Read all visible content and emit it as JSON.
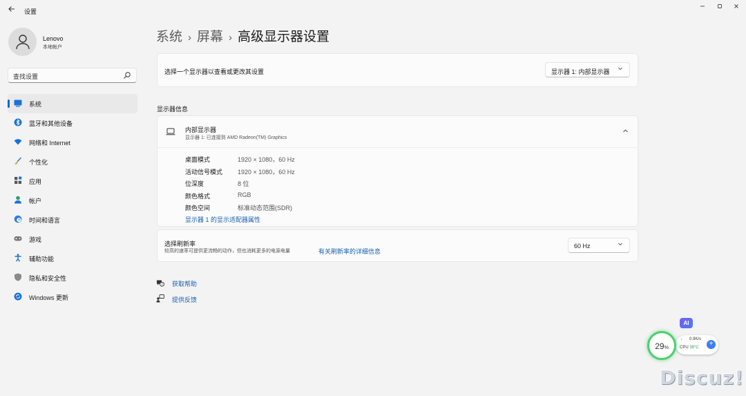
{
  "window": {
    "title": "设置",
    "back_icon": "back-arrow-icon",
    "controls": [
      "minimize",
      "maximize",
      "close"
    ]
  },
  "user": {
    "name": "Lenovo",
    "account": "本地帐户"
  },
  "search": {
    "placeholder": "查找设置"
  },
  "sidebar": {
    "items": [
      {
        "label": "系统",
        "icon": "system-icon",
        "active": true
      },
      {
        "label": "蓝牙和其他设备",
        "icon": "bluetooth-icon"
      },
      {
        "label": "网络和 Internet",
        "icon": "network-icon"
      },
      {
        "label": "个性化",
        "icon": "brush-icon"
      },
      {
        "label": "应用",
        "icon": "apps-icon"
      },
      {
        "label": "帐户",
        "icon": "account-icon"
      },
      {
        "label": "时间和语言",
        "icon": "globe-clock-icon"
      },
      {
        "label": "游戏",
        "icon": "gamepad-icon"
      },
      {
        "label": "辅助功能",
        "icon": "accessibility-icon"
      },
      {
        "label": "隐私和安全性",
        "icon": "shield-icon"
      },
      {
        "label": "Windows 更新",
        "icon": "update-icon"
      }
    ]
  },
  "breadcrumb": {
    "items": [
      "系统",
      "屏幕",
      "高级显示器设置"
    ],
    "separator": "›"
  },
  "display_select": {
    "label": "选择一个显示器以查看或更改其设置",
    "value": "显示器 1: 内部显示器"
  },
  "display_info": {
    "section_title": "显示器信息",
    "name": "内部显示器",
    "subtitle": "显示器 1: 已连接到 AMD Radeon(TM) Graphics",
    "rows": [
      {
        "label": "桌面模式",
        "value": "1920 × 1080，60 Hz"
      },
      {
        "label": "活动信号模式",
        "value": "1920 × 1080，60 Hz"
      },
      {
        "label": "位深度",
        "value": "8 位"
      },
      {
        "label": "颜色格式",
        "value": "RGB"
      },
      {
        "label": "颜色空间",
        "value": "标准动态范围(SDR)"
      }
    ],
    "adapter_link": "显示器 1 的显示适配器属性"
  },
  "refresh": {
    "title": "选择刷新率",
    "description": "较高的速率可提供更流畅的动作，但也消耗更多的电源电量",
    "link": "有关刷新率的详细信息",
    "value": "60 Hz"
  },
  "help": {
    "get_help": "获取帮助",
    "feedback": "提供反馈"
  },
  "widget": {
    "ai_label": "AI",
    "gauge_value": "29",
    "gauge_unit": "%",
    "net_speed": "0.9K/s",
    "cpu_label": "CPU",
    "cpu_temp": "38°C",
    "accent": "#4ccf6c"
  },
  "watermark": "Discuz!",
  "colors": {
    "accent": "#1669bf",
    "link": "#1660b0",
    "background": "#f3f3f3",
    "card": "#fbfbfb"
  }
}
